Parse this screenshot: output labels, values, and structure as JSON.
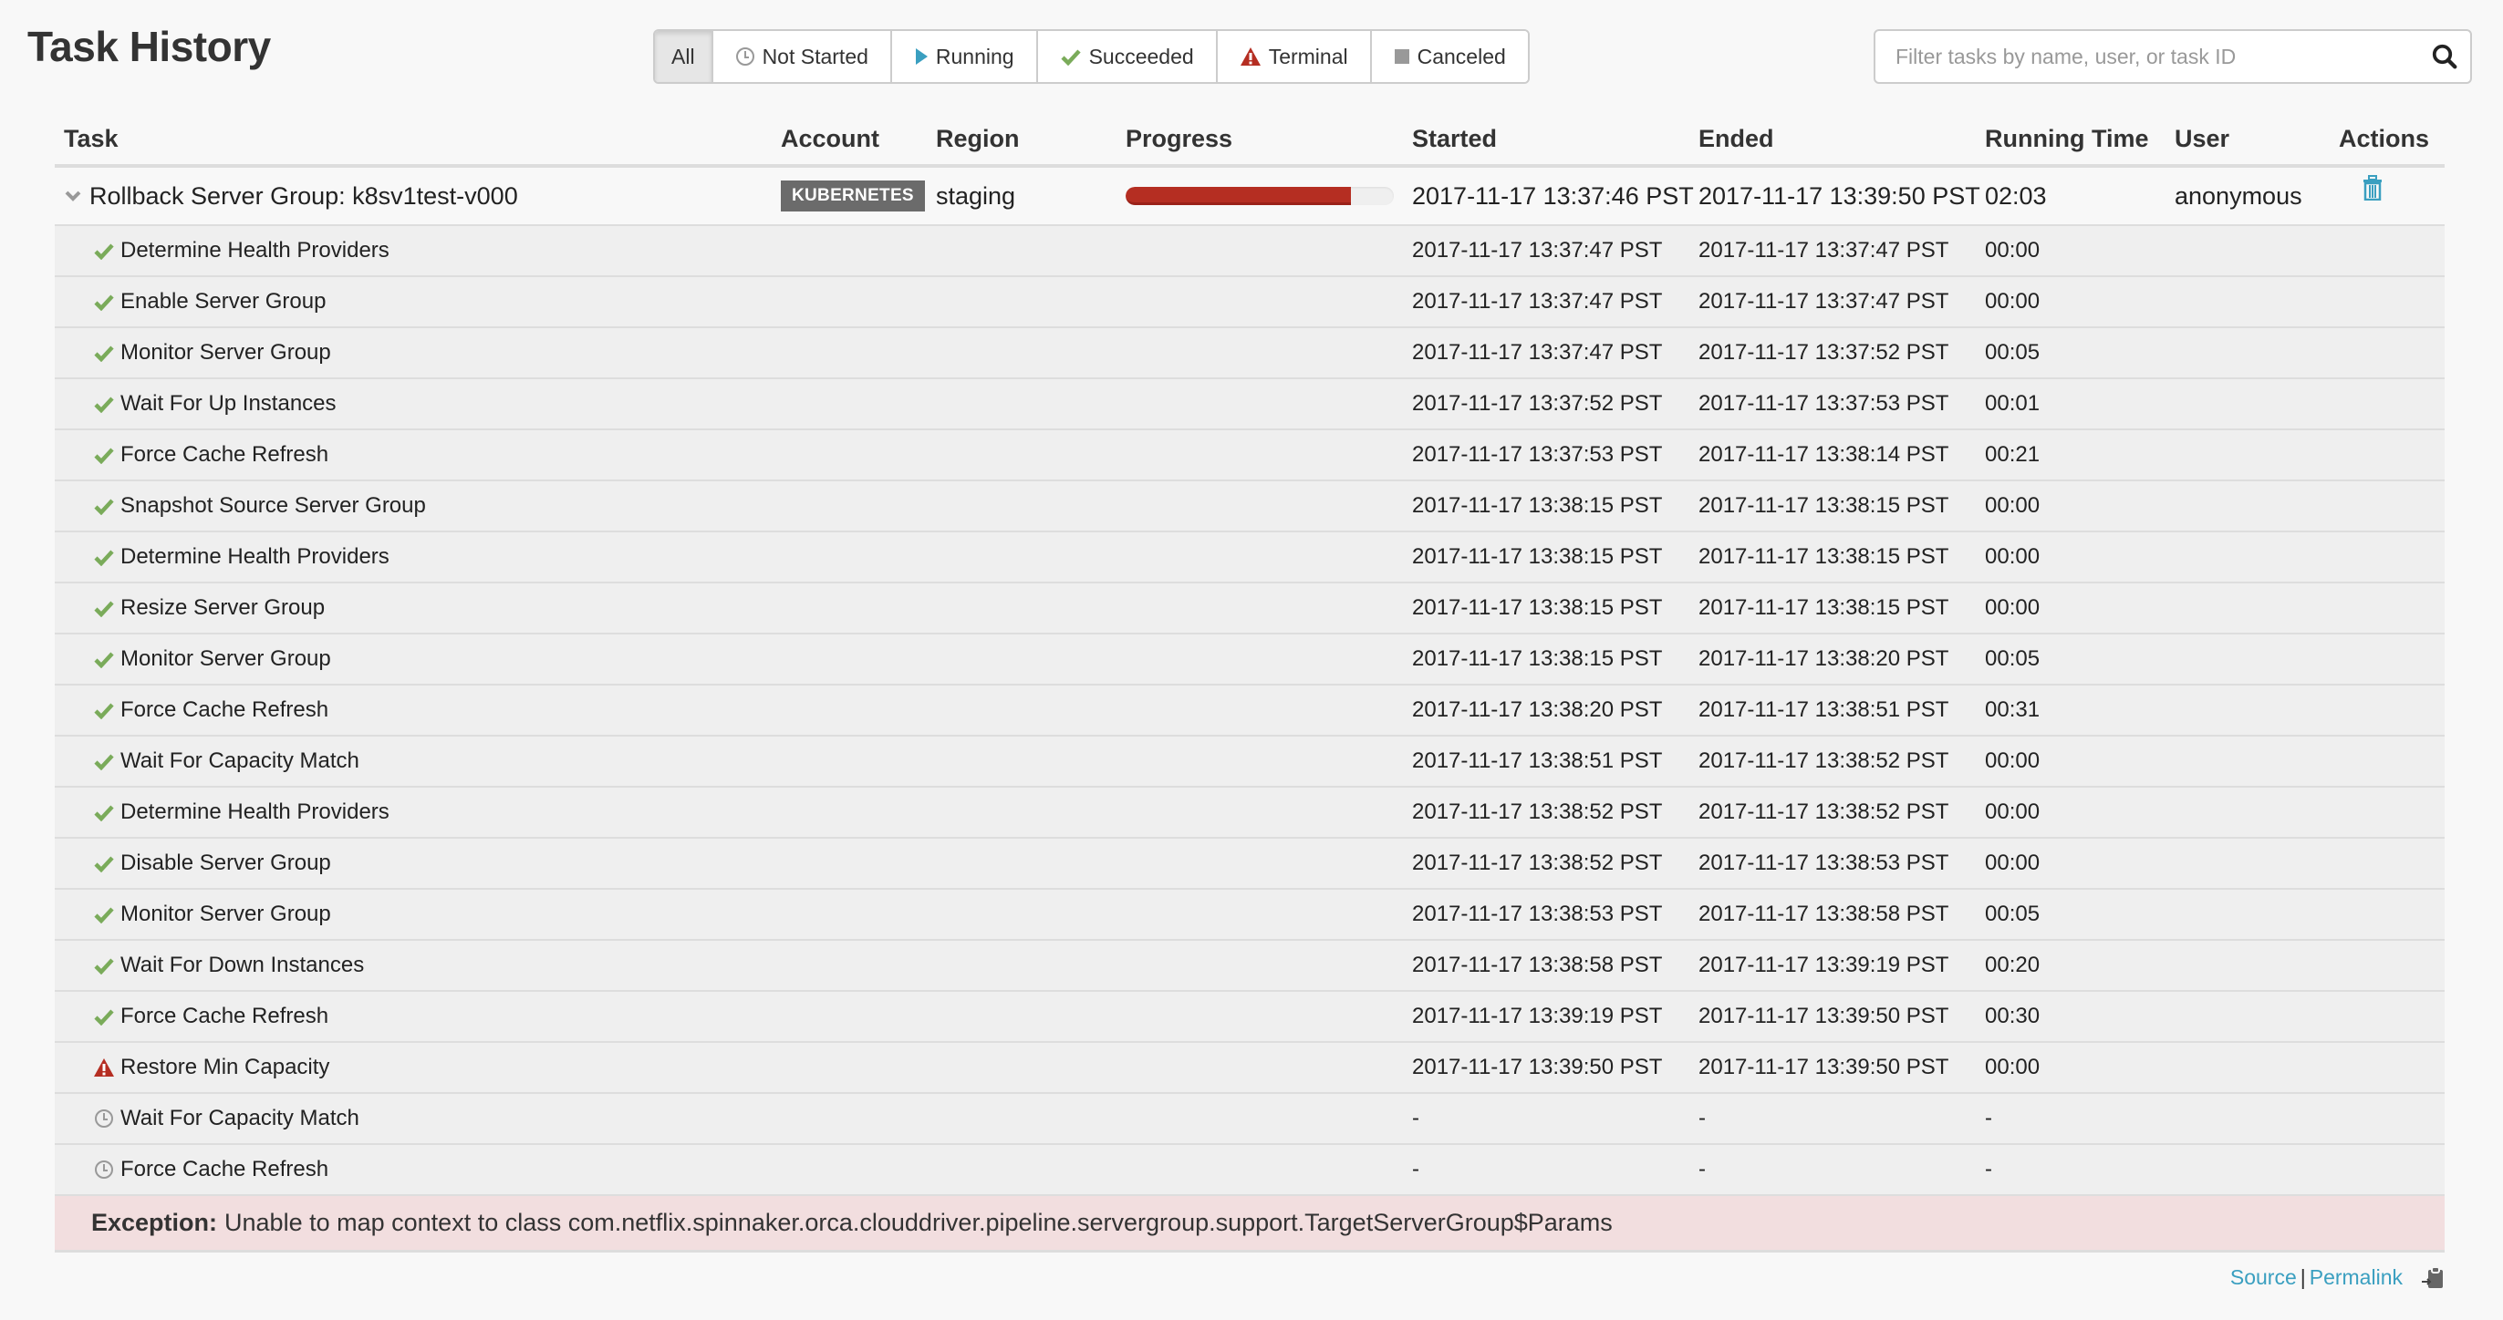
{
  "page_title": "Task History",
  "filters": [
    {
      "label": "All",
      "icon": "none",
      "active": true
    },
    {
      "label": "Not Started",
      "icon": "clock-icon",
      "active": false
    },
    {
      "label": "Running",
      "icon": "play-icon",
      "active": false
    },
    {
      "label": "Succeeded",
      "icon": "check-icon",
      "active": false
    },
    {
      "label": "Terminal",
      "icon": "warning-icon",
      "active": false
    },
    {
      "label": "Canceled",
      "icon": "square-icon",
      "active": false
    }
  ],
  "search": {
    "placeholder": "Filter tasks by name, user, or task ID",
    "value": ""
  },
  "colors": {
    "succeeded": "#7aab5a",
    "terminal": "#b52e22",
    "running": "#3a9fc0",
    "not_started": "#999999",
    "canceled": "#999999",
    "progress_fill": "#b52e22",
    "link": "#3a9fc0",
    "exception_bg": "#f2dedf",
    "badge_bg": "#6b6b6b"
  },
  "table": {
    "headers": {
      "task": "Task",
      "account": "Account",
      "region": "Region",
      "progress": "Progress",
      "started": "Started",
      "ended": "Ended",
      "running_time": "Running Time",
      "user": "User",
      "actions": "Actions"
    },
    "task": {
      "name": "Rollback Server Group: k8sv1test-v000",
      "expanded": true,
      "account": "KUBERNETES",
      "region": "staging",
      "progress_percent": 84,
      "started": "2017-11-17 13:37:46 PST",
      "ended": "2017-11-17 13:39:50 PST",
      "running_time": "02:03",
      "user": "anonymous",
      "actions": [
        "delete"
      ]
    },
    "steps": [
      {
        "name": "Determine Health Providers",
        "status": "succeeded",
        "started": "2017-11-17 13:37:47 PST",
        "ended": "2017-11-17 13:37:47 PST",
        "running_time": "00:00"
      },
      {
        "name": "Enable Server Group",
        "status": "succeeded",
        "started": "2017-11-17 13:37:47 PST",
        "ended": "2017-11-17 13:37:47 PST",
        "running_time": "00:00"
      },
      {
        "name": "Monitor Server Group",
        "status": "succeeded",
        "started": "2017-11-17 13:37:47 PST",
        "ended": "2017-11-17 13:37:52 PST",
        "running_time": "00:05"
      },
      {
        "name": "Wait For Up Instances",
        "status": "succeeded",
        "started": "2017-11-17 13:37:52 PST",
        "ended": "2017-11-17 13:37:53 PST",
        "running_time": "00:01"
      },
      {
        "name": "Force Cache Refresh",
        "status": "succeeded",
        "started": "2017-11-17 13:37:53 PST",
        "ended": "2017-11-17 13:38:14 PST",
        "running_time": "00:21"
      },
      {
        "name": "Snapshot Source Server Group",
        "status": "succeeded",
        "started": "2017-11-17 13:38:15 PST",
        "ended": "2017-11-17 13:38:15 PST",
        "running_time": "00:00"
      },
      {
        "name": "Determine Health Providers",
        "status": "succeeded",
        "started": "2017-11-17 13:38:15 PST",
        "ended": "2017-11-17 13:38:15 PST",
        "running_time": "00:00"
      },
      {
        "name": "Resize Server Group",
        "status": "succeeded",
        "started": "2017-11-17 13:38:15 PST",
        "ended": "2017-11-17 13:38:15 PST",
        "running_time": "00:00"
      },
      {
        "name": "Monitor Server Group",
        "status": "succeeded",
        "started": "2017-11-17 13:38:15 PST",
        "ended": "2017-11-17 13:38:20 PST",
        "running_time": "00:05"
      },
      {
        "name": "Force Cache Refresh",
        "status": "succeeded",
        "started": "2017-11-17 13:38:20 PST",
        "ended": "2017-11-17 13:38:51 PST",
        "running_time": "00:31"
      },
      {
        "name": "Wait For Capacity Match",
        "status": "succeeded",
        "started": "2017-11-17 13:38:51 PST",
        "ended": "2017-11-17 13:38:52 PST",
        "running_time": "00:00"
      },
      {
        "name": "Determine Health Providers",
        "status": "succeeded",
        "started": "2017-11-17 13:38:52 PST",
        "ended": "2017-11-17 13:38:52 PST",
        "running_time": "00:00"
      },
      {
        "name": "Disable Server Group",
        "status": "succeeded",
        "started": "2017-11-17 13:38:52 PST",
        "ended": "2017-11-17 13:38:53 PST",
        "running_time": "00:00"
      },
      {
        "name": "Monitor Server Group",
        "status": "succeeded",
        "started": "2017-11-17 13:38:53 PST",
        "ended": "2017-11-17 13:38:58 PST",
        "running_time": "00:05"
      },
      {
        "name": "Wait For Down Instances",
        "status": "succeeded",
        "started": "2017-11-17 13:38:58 PST",
        "ended": "2017-11-17 13:39:19 PST",
        "running_time": "00:20"
      },
      {
        "name": "Force Cache Refresh",
        "status": "succeeded",
        "started": "2017-11-17 13:39:19 PST",
        "ended": "2017-11-17 13:39:50 PST",
        "running_time": "00:30"
      },
      {
        "name": "Restore Min Capacity",
        "status": "terminal",
        "started": "2017-11-17 13:39:50 PST",
        "ended": "2017-11-17 13:39:50 PST",
        "running_time": "00:00"
      },
      {
        "name": "Wait For Capacity Match",
        "status": "not_started",
        "started": "-",
        "ended": "-",
        "running_time": "-"
      },
      {
        "name": "Force Cache Refresh",
        "status": "not_started",
        "started": "-",
        "ended": "-",
        "running_time": "-"
      }
    ],
    "exception": {
      "label": "Exception:",
      "message": "Unable to map context to class com.netflix.spinnaker.orca.clouddriver.pipeline.servergroup.support.TargetServerGroup$Params"
    }
  },
  "footer": {
    "source_label": "Source",
    "separator": "|",
    "permalink_label": "Permalink",
    "copy_icon": "clipboard-icon"
  }
}
